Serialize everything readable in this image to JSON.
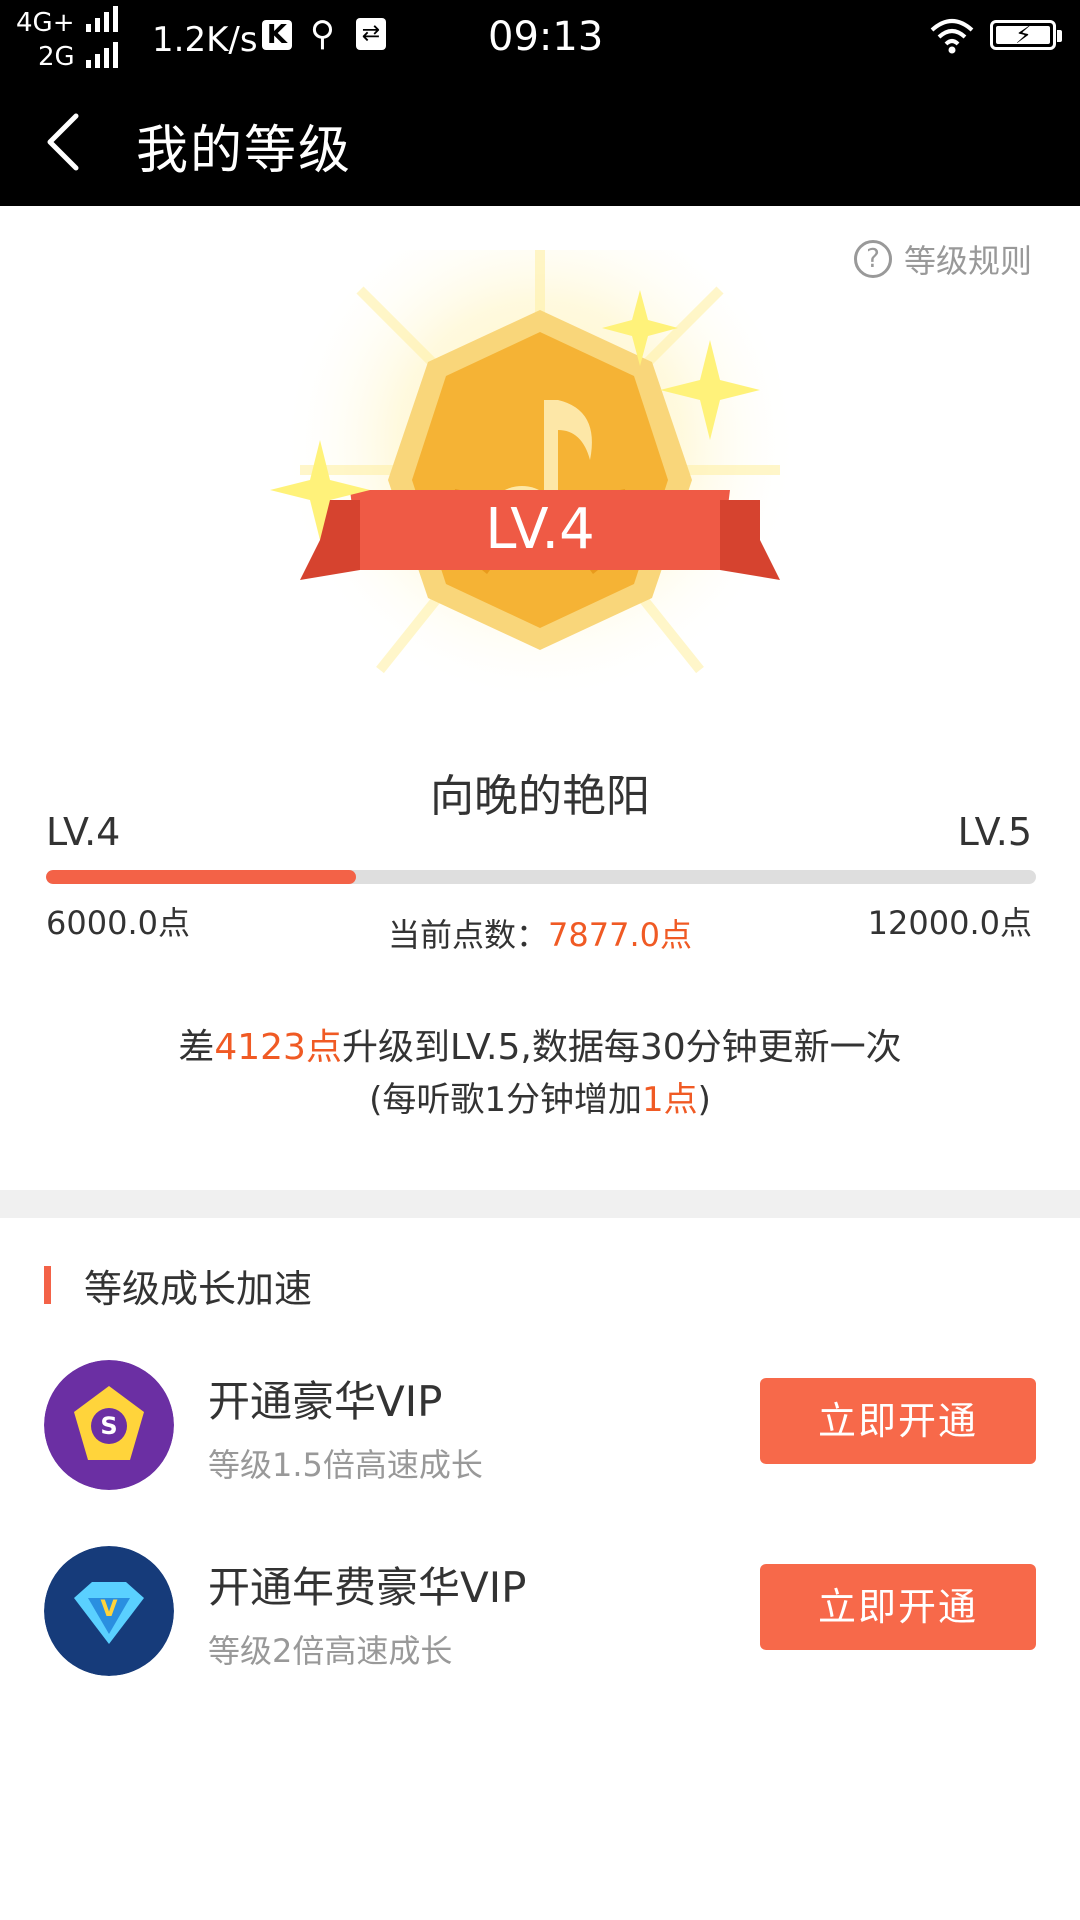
{
  "status_bar": {
    "network_top": "4G+",
    "network_bottom": "2G",
    "speed": "1.2K/s",
    "k_badge": "K",
    "time": "09:13"
  },
  "nav": {
    "title": "我的等级"
  },
  "rules": {
    "label": "等级规则",
    "icon": "?"
  },
  "badge": {
    "level": "LV.4"
  },
  "user": {
    "name": "向晚的艳阳"
  },
  "progress": {
    "current_level": "LV.4",
    "next_level": "LV.5",
    "min_points": "6000.0点",
    "max_points": "12000.0点",
    "current_label": "当前点数：",
    "current_value": "7877.0点",
    "fraction": 0.3128
  },
  "info": {
    "line1_a": "差",
    "line1_b": "4123点",
    "line1_c": "升级到LV.5,数据每30分钟更新一次",
    "line2_a": "(每听歌1分钟增加",
    "line2_b": "1点",
    "line2_c": ")"
  },
  "section": {
    "title": "等级成长加速"
  },
  "vip_rows": [
    {
      "title": "开通豪华VIP",
      "subtitle": "等级1.5倍高速成长",
      "button": "立即开通"
    },
    {
      "title": "开通年费豪华VIP",
      "subtitle": "等级2倍高速成长",
      "button": "立即开通"
    }
  ],
  "colors": {
    "accent": "#f36247",
    "highlight_text": "#f05a24",
    "badge_gold": "#f5b335",
    "ribbon": "#ef5a45"
  }
}
